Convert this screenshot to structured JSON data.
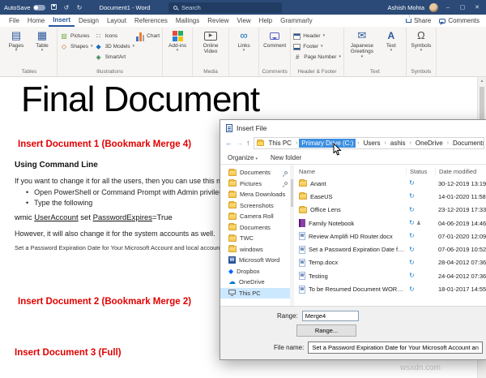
{
  "watermark": "wsxdn.com",
  "titlebar": {
    "autosave_label": "AutoSave",
    "document_title": "Document1 - Word",
    "search_label": "Search",
    "user_name": "Ashish Mohta"
  },
  "menubar": {
    "tabs": [
      "File",
      "Home",
      "Insert",
      "Design",
      "Layout",
      "References",
      "Mailings",
      "Review",
      "View",
      "Help",
      "Grammarly"
    ],
    "active_tab": "Insert",
    "share_label": "Share",
    "comments_label": "Comments"
  },
  "ribbon": {
    "tables_group": "Tables",
    "pages": "Pages",
    "table": "Table",
    "illustrations_group": "Illustrations",
    "pictures": "Pictures",
    "shapes": "Shapes",
    "icons": "Icons",
    "models": "3D Models",
    "smartart": "SmartArt",
    "chart": "Chart",
    "addins": "Add-ins",
    "media_group": "Media",
    "online_video": "Online Video",
    "links": "Links",
    "comments_group": "Comments",
    "comment": "Comment",
    "header_footer_group": "Header & Footer",
    "header": "Header",
    "footer": "Footer",
    "page_number": "Page Number",
    "text_group": "Text",
    "japanese": "Japanese Greetings",
    "text_box": "Text",
    "symbols_group": "Symbols",
    "symbols": "Symbols"
  },
  "document": {
    "title": "Final Document",
    "heading1": "Insert Document 1 (Bookmark Merge 4)",
    "subheading": "Using Command Line",
    "para1": "If you want to change it for all the users, then you can use this method.",
    "bullet1": "Open PowerShell or Command Prompt with Admin privileges.",
    "bullet2": "Type the following",
    "command": {
      "prefix": "wmic ",
      "word1": "UserAccount",
      "mid": " set ",
      "word2": "PasswordExpires",
      "suffix": "=True"
    },
    "para2": "However, it will also change it for the system accounts as well.",
    "note": "Set a Password Expiration Date for Your Microsoft Account and local account",
    "heading2": "Insert Document 2 (Bookmark Merge 2)",
    "heading3": "Insert Document 3 (Full)"
  },
  "dialog": {
    "title": "Insert File",
    "breadcrumb": {
      "segments": [
        "This PC",
        "Primary Drive (C:)",
        "Users",
        "ashis",
        "OneDrive",
        "Documents"
      ],
      "highlighted": "Primary Drive (C:)"
    },
    "toolbar": {
      "organize": "Organize",
      "new_folder": "New folder"
    },
    "sidebar": [
      {
        "label": "Documents",
        "icon": "folder",
        "pinned": true
      },
      {
        "label": "Pictures",
        "icon": "folder",
        "pinned": true
      },
      {
        "label": "Mera Downloads",
        "icon": "folder",
        "pinned": false
      },
      {
        "label": "Screenshots",
        "icon": "folder",
        "pinned": false
      },
      {
        "label": "Camera Roll",
        "icon": "folder",
        "pinned": false
      },
      {
        "label": "Documents",
        "icon": "folder",
        "pinned": false
      },
      {
        "label": "TWC",
        "icon": "folder",
        "pinned": false
      },
      {
        "label": "windows",
        "icon": "folder",
        "pinned": false
      },
      {
        "label": "Microsoft Word",
        "icon": "word",
        "pinned": false
      },
      {
        "label": "Dropbox",
        "icon": "dropbox",
        "pinned": false
      },
      {
        "label": "OneDrive",
        "icon": "onedrive",
        "pinned": false
      },
      {
        "label": "This PC",
        "icon": "pc",
        "pinned": false,
        "selected": true
      }
    ],
    "list": {
      "columns": [
        "Name",
        "Status",
        "Date modified"
      ],
      "rows": [
        {
          "name": "Anant",
          "type": "folder",
          "date": "30-12-2019 13:19"
        },
        {
          "name": "EaseUS",
          "type": "folder",
          "date": "14-01-2020 11:58"
        },
        {
          "name": "Office Lens",
          "type": "folder",
          "date": "23-12-2019 17:33"
        },
        {
          "name": "Family Notebook",
          "type": "notebook",
          "shared": true,
          "date": "04-06-2019 14:46"
        },
        {
          "name": "Review Amplifi HD Router.docx",
          "type": "word",
          "date": "07-01-2020 12:09"
        },
        {
          "name": "Set a Password Expiration Date for Your Microsoft Account and local account",
          "type": "word",
          "date": "07-06-2019 10:52"
        },
        {
          "name": "Temp.docx",
          "type": "word",
          "date": "28-04-2012 07:36"
        },
        {
          "name": "Testing",
          "type": "word",
          "date": "24-04-2012 07:36"
        },
        {
          "name": "To be Resumed Document WORD MOBILE",
          "type": "word",
          "date": "18-01-2017 14:55"
        }
      ]
    },
    "range": {
      "label": "Range:",
      "value": "Merge4",
      "button": "Range..."
    },
    "file_name": {
      "label": "File name:",
      "value": "Set a Password Expiration Date for Your Microsoft Account and local account"
    }
  }
}
